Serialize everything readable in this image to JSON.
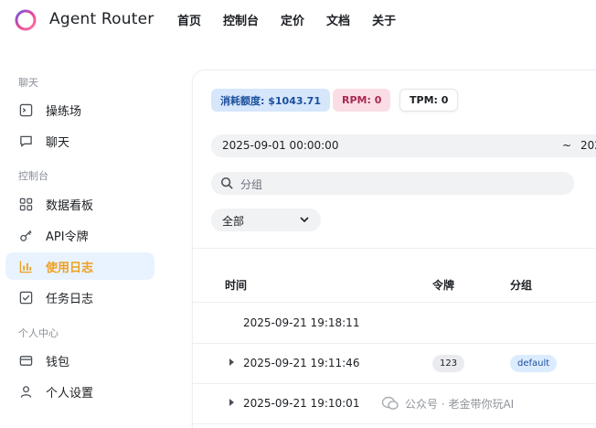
{
  "header": {
    "brand": "Agent Router",
    "nav": [
      "首页",
      "控制台",
      "定价",
      "文档",
      "关于"
    ]
  },
  "sidebar": {
    "groups": [
      {
        "label": "聊天",
        "items": [
          {
            "label": "操练场",
            "icon": "playground-icon"
          },
          {
            "label": "聊天",
            "icon": "chat-icon"
          }
        ]
      },
      {
        "label": "控制台",
        "items": [
          {
            "label": "数据看板",
            "icon": "dashboard-icon"
          },
          {
            "label": "API令牌",
            "icon": "key-icon"
          },
          {
            "label": "使用日志",
            "icon": "bar-chart-icon",
            "active": true
          },
          {
            "label": "任务日志",
            "icon": "task-icon"
          }
        ]
      },
      {
        "label": "个人中心",
        "items": [
          {
            "label": "钱包",
            "icon": "wallet-icon"
          },
          {
            "label": "个人设置",
            "icon": "user-icon"
          }
        ]
      }
    ]
  },
  "stats": {
    "usage": "消耗额度: $1043.71",
    "rpm": "RPM: 0",
    "tpm": "TPM: 0"
  },
  "filters": {
    "date_start": "2025-09-01 00:00:00",
    "date_sep": "~",
    "date_end": "202",
    "group_placeholder": "分组",
    "type_select": "全部"
  },
  "table": {
    "headers": [
      "时间",
      "令牌",
      "分组"
    ],
    "rows": [
      {
        "time": "2025-09-21 19:18:11",
        "token": "",
        "group": "",
        "expandable": false
      },
      {
        "time": "2025-09-21 19:11:46",
        "token": "123",
        "group": "default",
        "expandable": true
      },
      {
        "time": "2025-09-21 19:10:01",
        "token": "",
        "group": "",
        "expandable": true
      }
    ]
  },
  "watermark": "公众号 · 老金带你玩AI",
  "colors": {
    "active_bg": "#e8f3ff",
    "active_text": "#f0a020",
    "usage_chip": "#d6e6fb",
    "rpm_chip": "#fbdde6"
  }
}
